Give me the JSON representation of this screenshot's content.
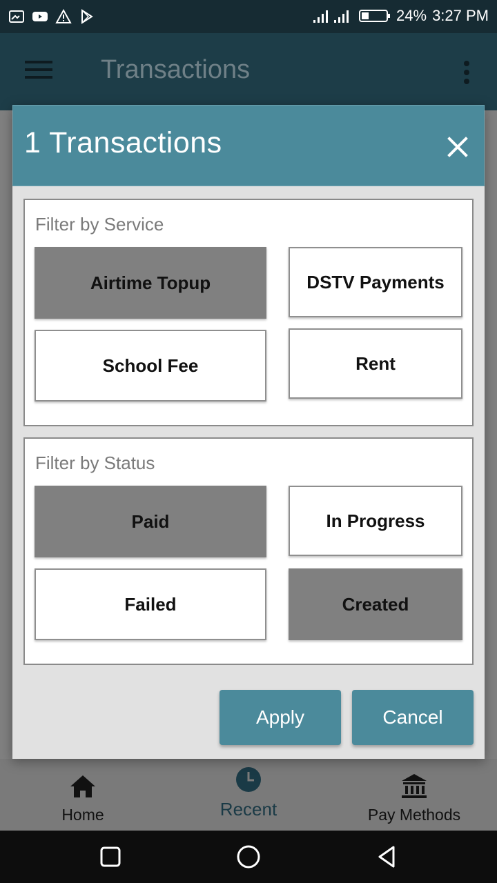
{
  "status_bar": {
    "battery": "24%",
    "time": "3:27 PM"
  },
  "app_bar": {
    "title": "Transactions"
  },
  "dialog": {
    "title": "1 Transactions",
    "service_filter": {
      "label": "Filter by Service",
      "options": [
        {
          "label": "Airtime Topup",
          "selected": true
        },
        {
          "label": "DSTV Payments",
          "selected": false
        },
        {
          "label": "School Fee",
          "selected": false
        },
        {
          "label": "Rent",
          "selected": false
        }
      ]
    },
    "status_filter": {
      "label": "Filter by Status",
      "options": [
        {
          "label": "Paid",
          "selected": true
        },
        {
          "label": "In Progress",
          "selected": false
        },
        {
          "label": "Failed",
          "selected": false
        },
        {
          "label": "Created",
          "selected": true
        }
      ]
    },
    "apply_label": "Apply",
    "cancel_label": "Cancel"
  },
  "bottom_nav": {
    "items": [
      {
        "label": "Home",
        "icon": "home-icon"
      },
      {
        "label": "Recent",
        "icon": "clock-icon",
        "active": true
      },
      {
        "label": "Pay Methods",
        "icon": "bank-icon"
      }
    ]
  },
  "colors": {
    "accent": "#4b8a9b",
    "selected_chip": "#808080"
  }
}
